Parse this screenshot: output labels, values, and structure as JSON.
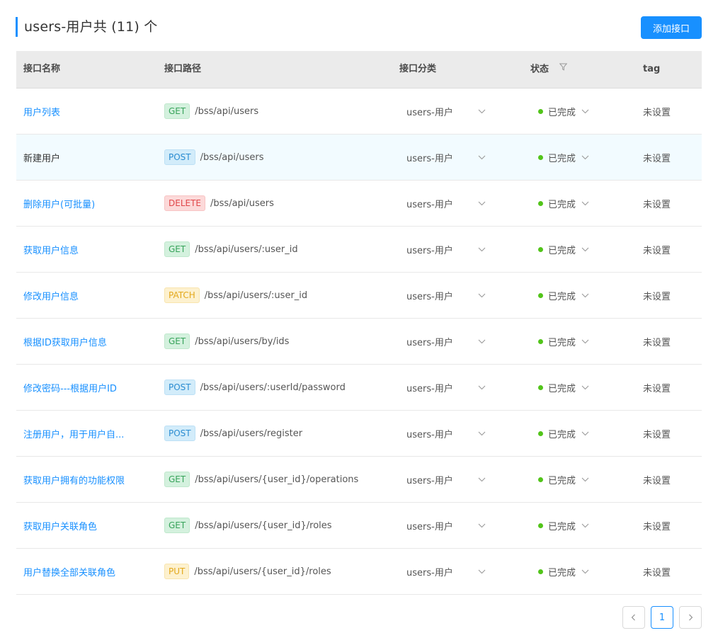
{
  "header": {
    "title": "users-用户共 (11) 个",
    "add_button": "添加接口"
  },
  "columns": {
    "name": "接口名称",
    "path": "接口路径",
    "category": "接口分类",
    "status": "状态",
    "tag": "tag"
  },
  "rows": [
    {
      "name": "用户列表",
      "method": "GET",
      "path": "/bss/api/users",
      "category": "users-用户",
      "status": "已完成",
      "tag": "未设置"
    },
    {
      "name": "新建用户",
      "method": "POST",
      "path": "/bss/api/users",
      "category": "users-用户",
      "status": "已完成",
      "tag": "未设置"
    },
    {
      "name": "删除用户(可批量)",
      "method": "DELETE",
      "path": "/bss/api/users",
      "category": "users-用户",
      "status": "已完成",
      "tag": "未设置"
    },
    {
      "name": "获取用户信息",
      "method": "GET",
      "path": "/bss/api/users/:user_id",
      "category": "users-用户",
      "status": "已完成",
      "tag": "未设置"
    },
    {
      "name": "修改用户信息",
      "method": "PATCH",
      "path": "/bss/api/users/:user_id",
      "category": "users-用户",
      "status": "已完成",
      "tag": "未设置"
    },
    {
      "name": "根据ID获取用户信息",
      "method": "GET",
      "path": "/bss/api/users/by/ids",
      "category": "users-用户",
      "status": "已完成",
      "tag": "未设置"
    },
    {
      "name": "修改密码---根据用户ID",
      "method": "POST",
      "path": "/bss/api/users/:userId/password",
      "category": "users-用户",
      "status": "已完成",
      "tag": "未设置"
    },
    {
      "name": "注册用户，用于用户自...",
      "method": "POST",
      "path": "/bss/api/users/register",
      "category": "users-用户",
      "status": "已完成",
      "tag": "未设置"
    },
    {
      "name": "获取用户拥有的功能权限",
      "method": "GET",
      "path": "/bss/api/users/{user_id}/operations",
      "category": "users-用户",
      "status": "已完成",
      "tag": "未设置"
    },
    {
      "name": "获取用户关联角色",
      "method": "GET",
      "path": "/bss/api/users/{user_id}/roles",
      "category": "users-用户",
      "status": "已完成",
      "tag": "未设置"
    },
    {
      "name": "用户替换全部关联角色",
      "method": "PUT",
      "path": "/bss/api/users/{user_id}/roles",
      "category": "users-用户",
      "status": "已完成",
      "tag": "未设置"
    }
  ],
  "pagination": {
    "current_page": "1"
  },
  "colors": {
    "accent": "#1890ff",
    "status_done": "#52c41a",
    "row_highlight": "#f2fbff"
  }
}
